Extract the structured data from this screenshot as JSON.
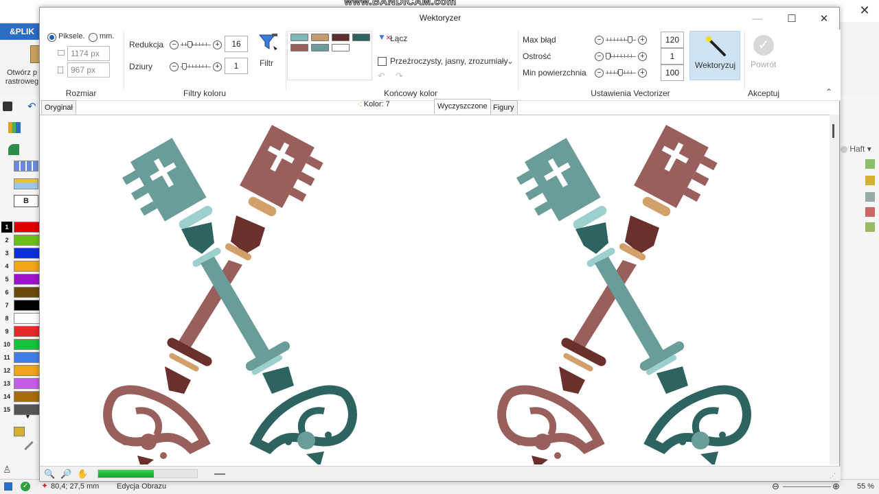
{
  "watermark": "www.BANDICAM.com",
  "host": {
    "menu_label": "&PLIK",
    "open_label_line1": "Otwórz p",
    "open_label_line2": "rastroweg",
    "right_dropdown_label": "Haft",
    "status_coords": "80,4; 27,5 mm",
    "status_mode": "Edycja Obrazu",
    "zoom": "55 %",
    "palette": [
      {
        "num": "1",
        "color": "#e00000"
      },
      {
        "num": "2",
        "color": "#6cbf1a"
      },
      {
        "num": "3",
        "color": "#0a2fe0"
      },
      {
        "num": "4",
        "color": "#f3a51a"
      },
      {
        "num": "5",
        "color": "#9b12c8"
      },
      {
        "num": "6",
        "color": "#6b4a08"
      },
      {
        "num": "7",
        "color": "#000000"
      },
      {
        "num": "8",
        "color": "#ffffff"
      },
      {
        "num": "9",
        "color": "#e62828"
      },
      {
        "num": "10",
        "color": "#14c43a"
      },
      {
        "num": "11",
        "color": "#3f7fe8"
      },
      {
        "num": "12",
        "color": "#f0a21a"
      },
      {
        "num": "13",
        "color": "#c65de8"
      },
      {
        "num": "14",
        "color": "#a86b0a"
      },
      {
        "num": "15",
        "color": "#555555"
      }
    ],
    "b_label": "B"
  },
  "dialog": {
    "title": "Wektoryzer",
    "size_group": {
      "label": "Rozmiar",
      "radio_pixels": "Piksele.",
      "radio_mm": "mm.",
      "width": "1174 px",
      "height": "967 px",
      "selected": "Piksele."
    },
    "color_filters": {
      "label": "Filtry koloru",
      "reduction_label": "Redukcja",
      "reduction_value": "16",
      "holes_label": "Dziury",
      "holes_value": "1",
      "filter_button": "Filtr"
    },
    "final_color": {
      "label": "Końcowy kolor",
      "merge_button": "Łącz",
      "transparent_label": "Przeźroczysty, jasny, zrozumiały",
      "swatches": [
        "#7fb6b6",
        "#c39a6b",
        "#5e2e2c",
        "#2d6461",
        "#985f5c",
        "#6a9c9a",
        "#ffffff"
      ]
    },
    "vectorizer_settings": {
      "label": "Ustawienia Vectorizer",
      "max_error_label": "Max błąd",
      "max_error_value": "120",
      "sharpness_label": "Ostrość",
      "sharpness_value": "1",
      "min_area_label": "Min powierzchnia",
      "min_area_value": "100"
    },
    "vectorize_button": "Wektoryzuj",
    "accept_group": {
      "label": "Akceptuj",
      "back_button": "Powrót"
    },
    "tabs": {
      "original": "Oryginał",
      "cleaned": "Wyczyszczone",
      "figures": "Figury",
      "active": "Wyczyszczone"
    },
    "color_count": "Kolor: 7",
    "progress": 0.56,
    "key_colors": {
      "teal": "#6a9c9a",
      "teal_light": "#9ecfcf",
      "teal_dark": "#2d6461",
      "rose": "#985f5c",
      "tan": "#d2a06a",
      "maroon": "#6a302d"
    }
  }
}
